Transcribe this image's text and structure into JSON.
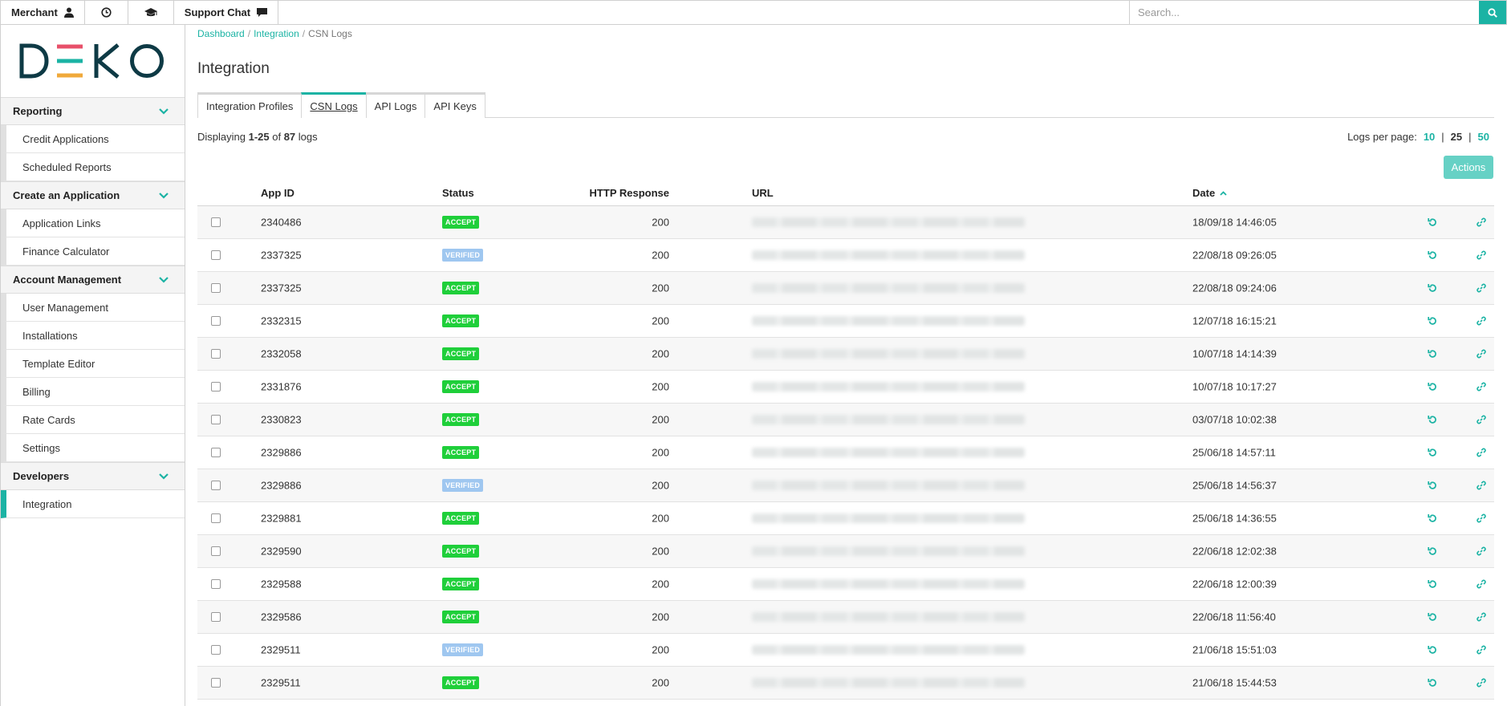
{
  "topbar": {
    "merchant_label": "Merchant",
    "support_label": "Support Chat",
    "search_placeholder": "Search..."
  },
  "logo": {
    "text": "DEKO",
    "colors": [
      "#e8506a",
      "#1bb3a4",
      "#f0a93b"
    ]
  },
  "sidebar": {
    "sections": [
      {
        "title": "Reporting",
        "items": [
          "Credit Applications",
          "Scheduled Reports"
        ]
      },
      {
        "title": "Create an Application",
        "items": [
          "Application Links",
          "Finance Calculator"
        ]
      },
      {
        "title": "Account Management",
        "items": [
          "User Management",
          "Installations",
          "Template Editor",
          "Billing",
          "Rate Cards",
          "Settings"
        ]
      },
      {
        "title": "Developers",
        "items": [
          "Integration"
        ]
      }
    ],
    "active_item": "Integration"
  },
  "breadcrumb": {
    "dashboard": "Dashboard",
    "integration": "Integration",
    "current": "CSN Logs"
  },
  "page_title": "Integration",
  "tabs": [
    "Integration Profiles",
    "CSN Logs",
    "API Logs",
    "API Keys"
  ],
  "active_tab": "CSN Logs",
  "summary": {
    "prefix": "Displaying ",
    "range": "1-25",
    "of": " of ",
    "total": "87",
    "suffix": " logs"
  },
  "per_page": {
    "label": "Logs per page:",
    "options": [
      "10",
      "25",
      "50"
    ],
    "current": "25"
  },
  "actions_label": "Actions",
  "table": {
    "headers": {
      "app_id": "App ID",
      "status": "Status",
      "http": "HTTP Response",
      "url": "URL",
      "date": "Date"
    },
    "rows": [
      {
        "app_id": "2340486",
        "status": "ACCEPT",
        "http": "200",
        "date": "18/09/18 14:46:05"
      },
      {
        "app_id": "2337325",
        "status": "VERIFIED",
        "http": "200",
        "date": "22/08/18 09:26:05"
      },
      {
        "app_id": "2337325",
        "status": "ACCEPT",
        "http": "200",
        "date": "22/08/18 09:24:06"
      },
      {
        "app_id": "2332315",
        "status": "ACCEPT",
        "http": "200",
        "date": "12/07/18 16:15:21"
      },
      {
        "app_id": "2332058",
        "status": "ACCEPT",
        "http": "200",
        "date": "10/07/18 14:14:39"
      },
      {
        "app_id": "2331876",
        "status": "ACCEPT",
        "http": "200",
        "date": "10/07/18 10:17:27"
      },
      {
        "app_id": "2330823",
        "status": "ACCEPT",
        "http": "200",
        "date": "03/07/18 10:02:38"
      },
      {
        "app_id": "2329886",
        "status": "ACCEPT",
        "http": "200",
        "date": "25/06/18 14:57:11"
      },
      {
        "app_id": "2329886",
        "status": "VERIFIED",
        "http": "200",
        "date": "25/06/18 14:56:37"
      },
      {
        "app_id": "2329881",
        "status": "ACCEPT",
        "http": "200",
        "date": "25/06/18 14:36:55"
      },
      {
        "app_id": "2329590",
        "status": "ACCEPT",
        "http": "200",
        "date": "22/06/18 12:02:38"
      },
      {
        "app_id": "2329588",
        "status": "ACCEPT",
        "http": "200",
        "date": "22/06/18 12:00:39"
      },
      {
        "app_id": "2329586",
        "status": "ACCEPT",
        "http": "200",
        "date": "22/06/18 11:56:40"
      },
      {
        "app_id": "2329511",
        "status": "VERIFIED",
        "http": "200",
        "date": "21/06/18 15:51:03"
      },
      {
        "app_id": "2329511",
        "status": "ACCEPT",
        "http": "200",
        "date": "21/06/18 15:44:53"
      }
    ]
  },
  "accent": "#1bb3a4"
}
